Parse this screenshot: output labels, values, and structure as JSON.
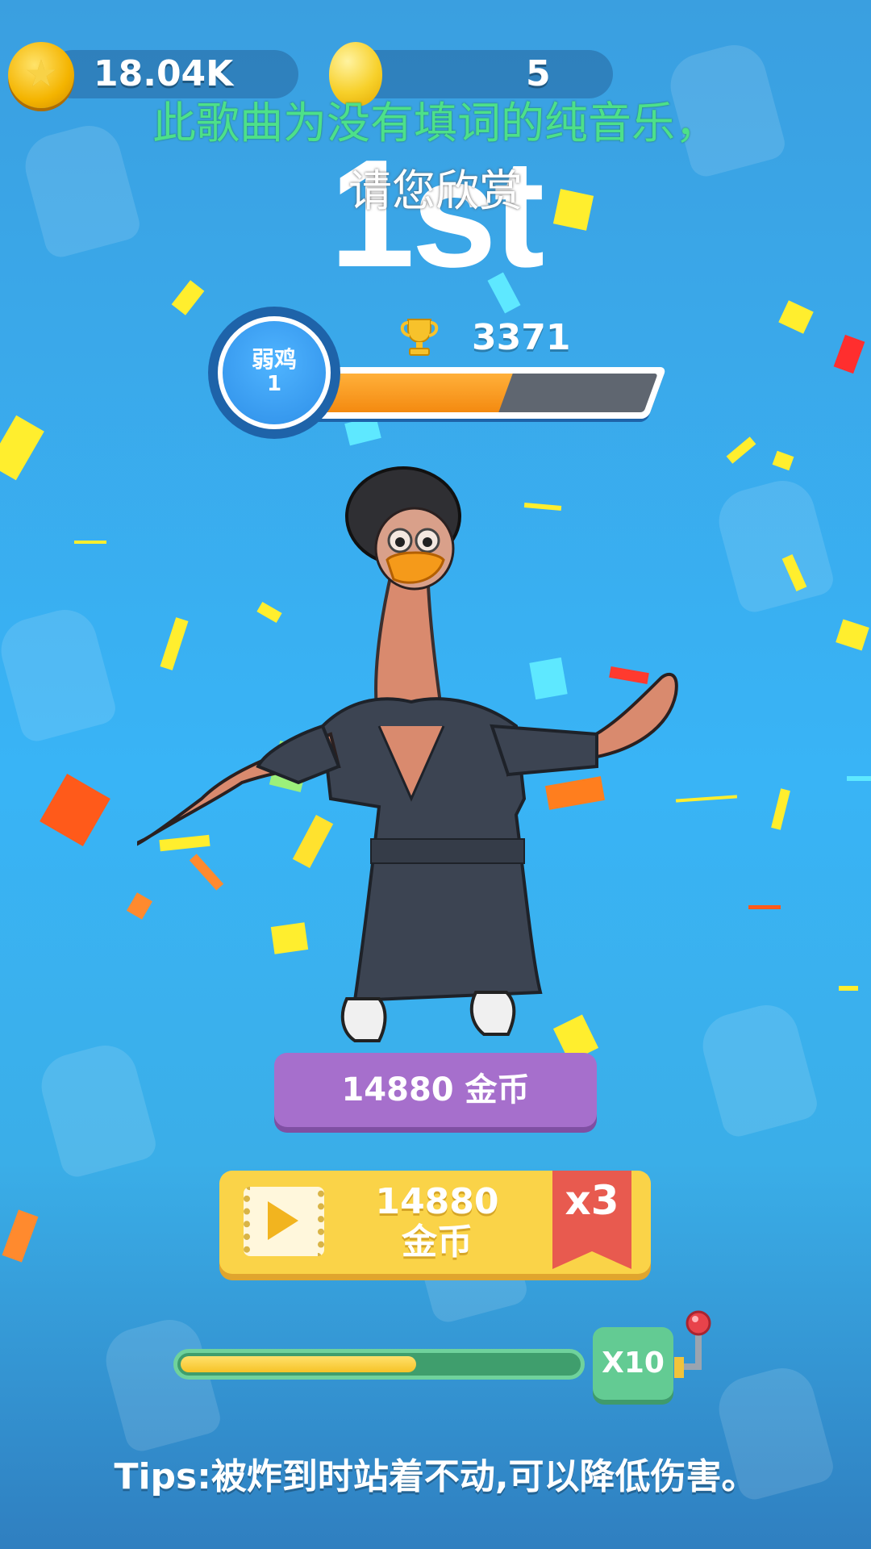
{
  "topbar": {
    "coins": "18.04K",
    "balloons": "5",
    "coin_icon": "gold-star-coin-icon",
    "balloon_icon": "yellow-balloon-icon"
  },
  "lyrics": {
    "line1": "此歌曲为没有填词的纯音乐，",
    "line2": "请您欣赏",
    "line1_color": "#4de08a",
    "line2_color": "#ffffff"
  },
  "result": {
    "rank": "1st"
  },
  "level": {
    "name": "弱鸡",
    "number": "1",
    "progress": 0.55,
    "trophy_icon": "trophy-icon",
    "score": "3371"
  },
  "rewards": {
    "claim_label": "14880  金币",
    "video_amount": "14880",
    "video_unit": "金币",
    "video_multiplier": "x3",
    "video_icon": "play-video-icon"
  },
  "multiplier": {
    "progress": 0.6,
    "label": "X10"
  },
  "tips": "Tips:被炸到时站着不动,可以降低伤害。",
  "colors": {
    "background": "#39b4f6",
    "purple_button": "#a66fcc",
    "yellow_button": "#fad348",
    "ribbon": "#e85a4f",
    "green_button": "#63cb93",
    "level_fill": "#f48a10"
  }
}
